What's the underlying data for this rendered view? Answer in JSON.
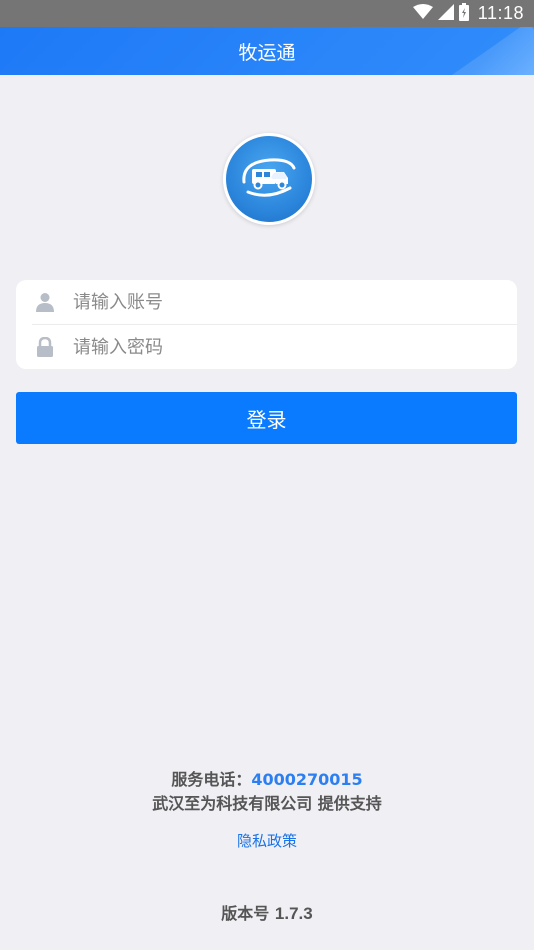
{
  "status_bar": {
    "time": "11:18",
    "icons": [
      "wifi-icon",
      "cell-signal-icon",
      "battery-icon"
    ]
  },
  "header": {
    "title": "牧运通"
  },
  "logo": {
    "icon": "truck-logo-icon",
    "color": "#2b86dc"
  },
  "form": {
    "account": {
      "placeholder": "请输入账号",
      "value": "",
      "icon": "user-icon"
    },
    "password": {
      "placeholder": "请输入密码",
      "value": "",
      "icon": "lock-icon"
    },
    "login_label": "登录"
  },
  "footer": {
    "phone_label": "服务电话：",
    "phone_number": "4000270015",
    "company": "武汉至为科技有限公司 提供支持",
    "privacy_label": "隐私政策",
    "version_label": "版本号",
    "version_number": "1.7.3"
  },
  "colors": {
    "accent": "#0a7bff",
    "header": "#1e79f7",
    "background": "#efeff4",
    "link": "#1a73e8"
  }
}
